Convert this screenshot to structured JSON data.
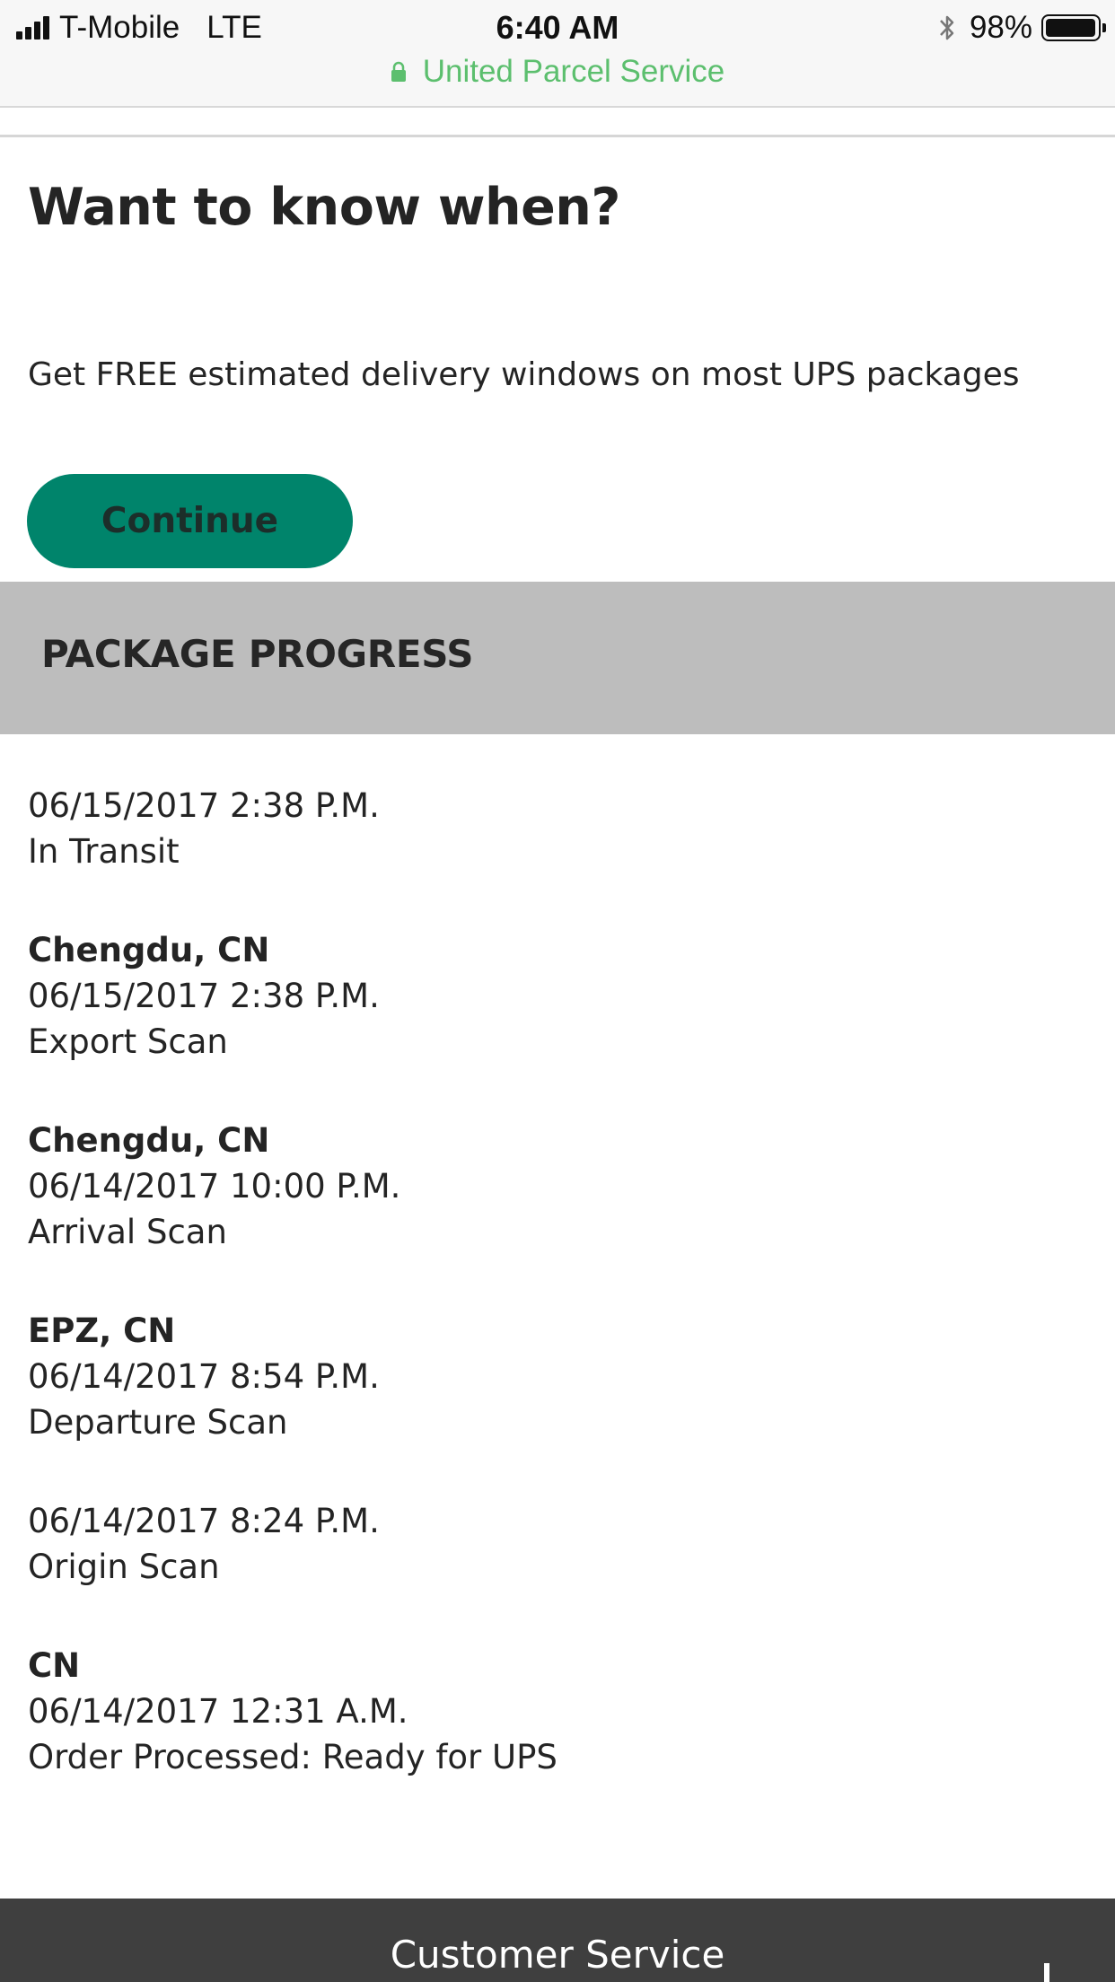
{
  "status_bar": {
    "carrier": "T-Mobile",
    "network": "LTE",
    "time": "6:40 AM",
    "battery": "98%",
    "battery_level": 0.98,
    "site": "United Parcel Service"
  },
  "promo": {
    "title": "Want to know when?",
    "text": "Get FREE estimated delivery windows on most UPS packages",
    "button_label": "Continue",
    "button_color": "#00846b"
  },
  "progress": {
    "heading": "PACKAGE PROGRESS",
    "events": [
      {
        "location": "",
        "datetime": "06/15/2017 2:38 P.M.",
        "status": "In Transit"
      },
      {
        "location": "Chengdu, CN",
        "datetime": "06/15/2017 2:38 P.M.",
        "status": "Export Scan"
      },
      {
        "location": "Chengdu, CN",
        "datetime": "06/14/2017 10:00 P.M.",
        "status": "Arrival Scan"
      },
      {
        "location": "EPZ, CN",
        "datetime": "06/14/2017 8:54 P.M.",
        "status": "Departure Scan"
      },
      {
        "location": "",
        "datetime": "06/14/2017 8:24 P.M.",
        "status": "Origin Scan"
      },
      {
        "location": "CN",
        "datetime": "06/14/2017 12:31 A.M.",
        "status": "Order Processed: Ready for UPS"
      }
    ]
  },
  "footer": {
    "label": "Customer Service"
  }
}
